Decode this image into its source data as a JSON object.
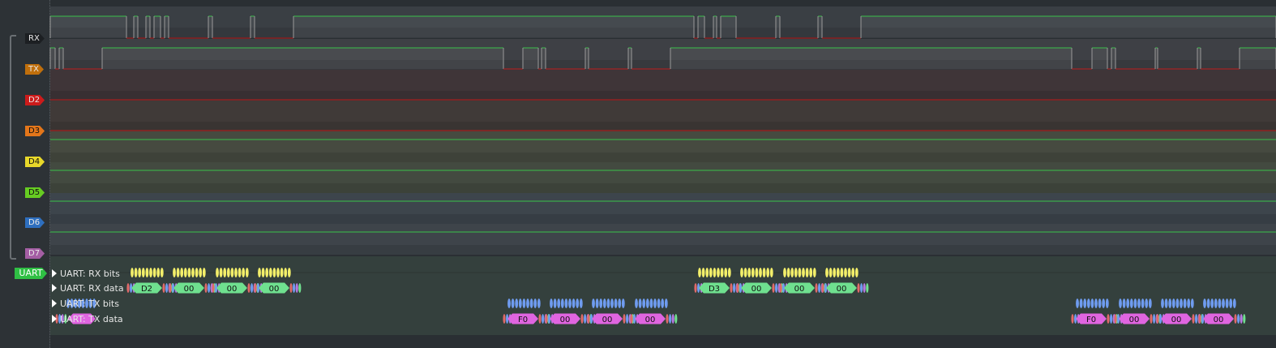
{
  "channels": [
    {
      "id": "RX",
      "label": "RX",
      "tag_color": "#1c1f22",
      "text": "light"
    },
    {
      "id": "TX",
      "label": "TX",
      "tag_color": "#c06f0c",
      "text": "light"
    },
    {
      "id": "D2",
      "label": "D2",
      "tag_color": "#cc1b1b",
      "text": "light"
    },
    {
      "id": "D3",
      "label": "D3",
      "tag_color": "#e3761a",
      "text": "dark"
    },
    {
      "id": "D4",
      "label": "D4",
      "tag_color": "#e8d82a",
      "text": "dark"
    },
    {
      "id": "D5",
      "label": "D5",
      "tag_color": "#66cc22",
      "text": "dark"
    },
    {
      "id": "D6",
      "label": "D6",
      "tag_color": "#2e6fbf",
      "text": "light"
    },
    {
      "id": "D7",
      "label": "D7",
      "tag_color": "#a45ea4",
      "text": "light"
    }
  ],
  "decoder": {
    "tag_label": "UART",
    "rows": [
      {
        "id": "rx-bits",
        "label": "UART: RX bits"
      },
      {
        "id": "rx-data",
        "label": "UART: RX data"
      },
      {
        "id": "tx-bits",
        "label": "UART: TX bits"
      },
      {
        "id": "tx-data",
        "label": "UART: TX data"
      }
    ],
    "rx_bytes": [
      [
        "D2",
        "00",
        "00",
        "00"
      ],
      [
        "D3",
        "00",
        "00",
        "00"
      ]
    ],
    "tx_bytes": [
      [
        "F0",
        "00",
        "00",
        "00"
      ],
      [
        "F0",
        "00",
        "00",
        "00"
      ]
    ]
  },
  "colors": {
    "high": "#39c24a",
    "low": "#c01b1b",
    "rx_data": "#6fe08f",
    "tx_data": "#e065e0",
    "bits_yellow": "#f3ef6a",
    "bits_blue": "#6f9cf0"
  }
}
